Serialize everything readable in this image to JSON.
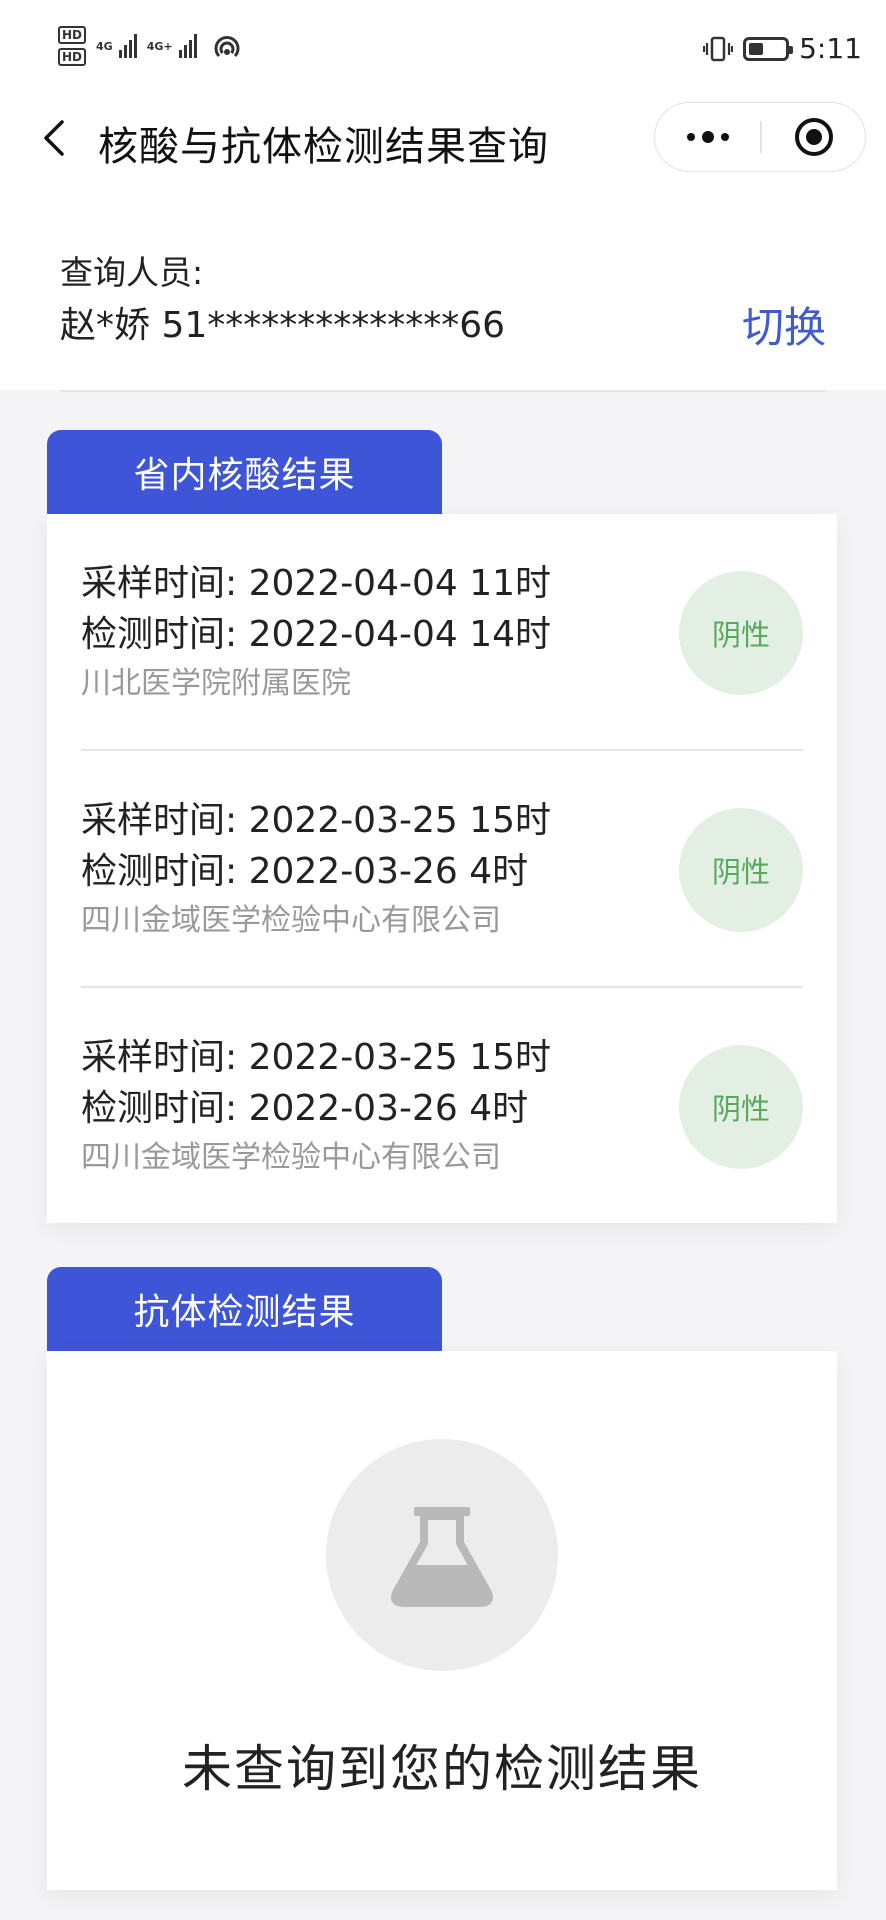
{
  "status_bar": {
    "hd1": "HD",
    "hd2": "HD",
    "net1": "4G",
    "net2": "4G+",
    "time": "5:11",
    "battery_level": 0.4
  },
  "nav": {
    "title": "核酸与抗体检测结果查询",
    "more_icon": "more-dots-icon",
    "close_icon": "target-circle-icon"
  },
  "person": {
    "label": "查询人员:",
    "value": "赵*娇 51**************66",
    "switch_label": "切换"
  },
  "nucleic": {
    "tab_label": "省内核酸结果",
    "records": [
      {
        "sample": "采样时间: 2022-04-04 11时",
        "test": "检测时间: 2022-04-04 14时",
        "org": "川北医学院附属医院",
        "result": "阴性"
      },
      {
        "sample": "采样时间: 2022-03-25 15时",
        "test": "检测时间: 2022-03-26 4时",
        "org": "四川金域医学检验中心有限公司",
        "result": "阴性"
      },
      {
        "sample": "采样时间: 2022-03-25 15时",
        "test": "检测时间: 2022-03-26 4时",
        "org": "四川金域医学检验中心有限公司",
        "result": "阴性"
      }
    ]
  },
  "antibody": {
    "tab_label": "抗体检测结果",
    "empty_icon": "flask-icon",
    "empty_text": "未查询到您的检测结果"
  },
  "colors": {
    "accent": "#3e55d8",
    "link": "#3f5bcc",
    "negative_badge_bg": "#e3efe3",
    "negative_badge_text": "#59a85f"
  }
}
